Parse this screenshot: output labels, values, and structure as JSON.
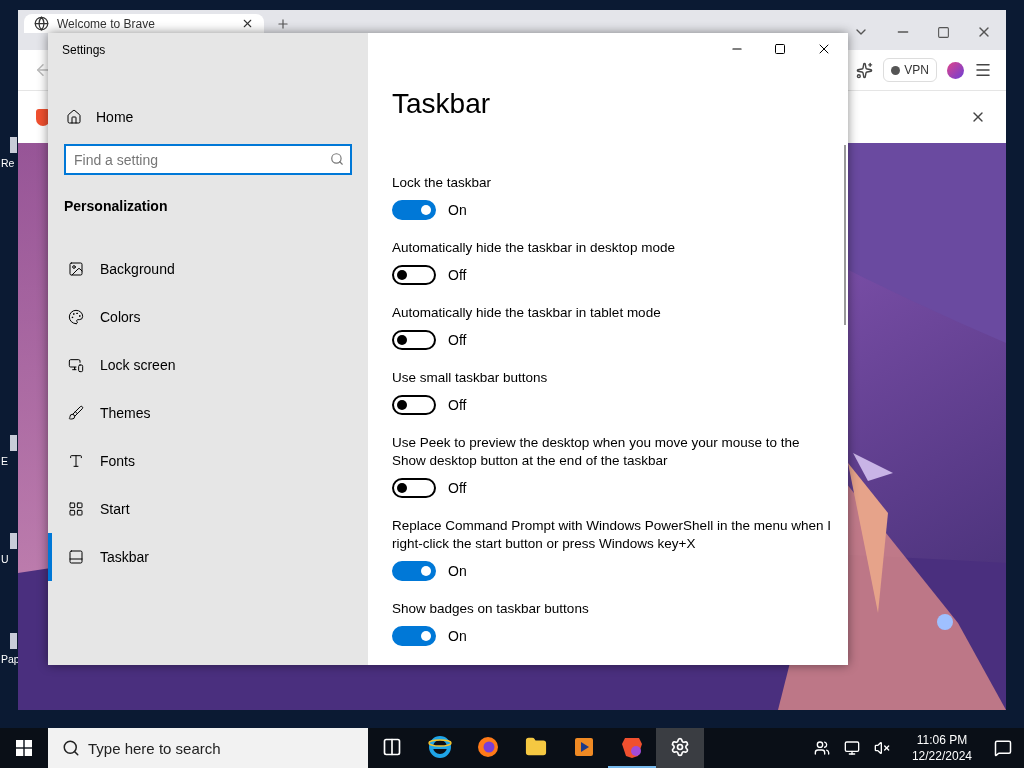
{
  "desktop": {
    "icon_labels": [
      "Re",
      "E",
      "U",
      "Pap"
    ]
  },
  "browser": {
    "tab_title": "Welcome to Brave",
    "vpn_label": "VPN"
  },
  "settings": {
    "window_title": "Settings",
    "home": "Home",
    "search": {
      "placeholder": "Find a setting"
    },
    "section": "Personalization",
    "nav": [
      {
        "label": "Background",
        "kind": "background",
        "selected": false
      },
      {
        "label": "Colors",
        "kind": "colors",
        "selected": false
      },
      {
        "label": "Lock screen",
        "kind": "lock",
        "selected": false
      },
      {
        "label": "Themes",
        "kind": "themes",
        "selected": false
      },
      {
        "label": "Fonts",
        "kind": "fonts",
        "selected": false
      },
      {
        "label": "Start",
        "kind": "start",
        "selected": false
      },
      {
        "label": "Taskbar",
        "kind": "taskbar",
        "selected": true
      }
    ],
    "page_title": "Taskbar",
    "options": [
      {
        "label": "Lock the taskbar",
        "on": true,
        "state_text": "On"
      },
      {
        "label": "Automatically hide the taskbar in desktop mode",
        "on": false,
        "state_text": "Off"
      },
      {
        "label": "Automatically hide the taskbar in tablet mode",
        "on": false,
        "state_text": "Off"
      },
      {
        "label": "Use small taskbar buttons",
        "on": false,
        "state_text": "Off"
      },
      {
        "label": "Use Peek to preview the desktop when you move your mouse to the Show desktop button at the end of the taskbar",
        "on": false,
        "state_text": "Off"
      },
      {
        "label": "Replace Command Prompt with Windows PowerShell in the menu when I right-click the start button or press Windows key+X",
        "on": true,
        "state_text": "On"
      },
      {
        "label": "Show badges on taskbar buttons",
        "on": true,
        "state_text": "On"
      }
    ]
  },
  "taskbar": {
    "search_placeholder": "Type here to search",
    "apps": [
      {
        "kind": "taskview",
        "active": false,
        "running": false
      },
      {
        "kind": "ie",
        "active": false,
        "running": false
      },
      {
        "kind": "firefox",
        "active": false,
        "running": false
      },
      {
        "kind": "explorer",
        "active": false,
        "running": false
      },
      {
        "kind": "media",
        "active": false,
        "running": false
      },
      {
        "kind": "brave",
        "active": false,
        "running": true
      },
      {
        "kind": "settings",
        "active": true,
        "running": false
      }
    ],
    "time": "11:06 PM",
    "date": "12/22/2024"
  }
}
